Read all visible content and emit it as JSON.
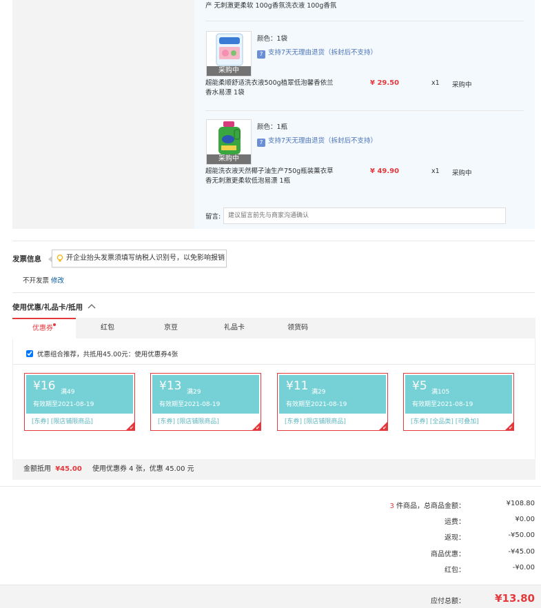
{
  "items": [
    {
      "top_desc": "产 无刺激更柔软 100g香氛洗衣液 100g香氛"
    },
    {
      "color_label": "颜色：1袋",
      "service_text": "支持7天无理由退货（拆封后不支持）",
      "service_icon": "7",
      "image_tag": "采购中",
      "name_line1": "超能柔顺舒适洗衣液500g植翠低泡馨香依兰",
      "name_line2": "香水易漂 1袋",
      "price": "¥ 29.50",
      "qty": "x1",
      "status": "采购中"
    },
    {
      "color_label": "颜色：1瓶",
      "service_text": "支持7天无理由退货（拆封后不支持）",
      "service_icon": "7",
      "image_tag": "采购中",
      "name_line1": "超能洗衣液天然椰子油生产750g瓶装薰衣草",
      "name_line2": "香无刺激更柔软低泡易漂 1瓶",
      "price": "¥ 49.90",
      "qty": "x1",
      "status": "采购中"
    }
  ],
  "memo": {
    "label": "留言:",
    "placeholder": "建议留言前先与商家沟通确认"
  },
  "invoice": {
    "title": "发票信息",
    "tip": "开企业抬头发票须填写纳税人识别号，以免影响报销",
    "status": "不开发票",
    "modify": "修改"
  },
  "discount": {
    "title": "使用优惠/礼品卡/抵用",
    "tabs": [
      "优惠券",
      "红包",
      "京豆",
      "礼品卡",
      "领货码"
    ],
    "recommend": "优惠组合推荐，共抵用45.00元：使用优惠券4张",
    "coupons": [
      {
        "amount": "¥16",
        "cond": "满49",
        "date": "有效期至2021-08-19",
        "tags": "[东券]  [限店铺限商品]"
      },
      {
        "amount": "¥13",
        "cond": "满29",
        "date": "有效期至2021-08-19",
        "tags": "[东券]  [限店铺限商品]"
      },
      {
        "amount": "¥11",
        "cond": "满29",
        "date": "有效期至2021-08-19",
        "tags": "[东券]  [限店铺限商品]"
      },
      {
        "amount": "¥5",
        "cond": "满105",
        "date": "有效期至2021-08-19",
        "tags": "[东券]  [全品类]  [可叠加]"
      }
    ],
    "deduct_label": "金额抵用",
    "deduct_value": "¥45.00",
    "deduct_note": "使用优惠券 4 张，优惠 45.00 元"
  },
  "summary": {
    "count": "3",
    "count_label": "件商品，总商品金额：",
    "total_goods": "¥108.80",
    "shipping_label": "运费：",
    "shipping": "¥0.00",
    "cashback_label": "返现：",
    "cashback": "-¥50.00",
    "goods_discount_label": "商品优惠：",
    "goods_discount": "-¥45.00",
    "redpack_label": "红包：",
    "redpack": "-¥0.00",
    "payable_label": "应付总额：",
    "payable": "¥13.80"
  },
  "colors": {
    "accent_red": "#e4393c",
    "coupon_teal": "#76d1d6",
    "link_blue": "#005aa0"
  }
}
